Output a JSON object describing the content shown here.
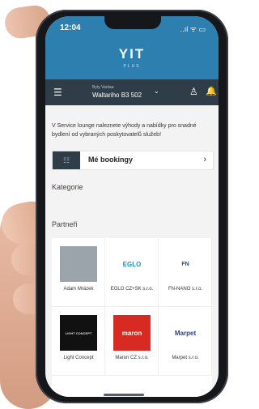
{
  "status": {
    "time": "12:04",
    "icons": "..ıl ᯤ ▭"
  },
  "brand": {
    "logo": "YIT",
    "sub": "PLUS"
  },
  "header": {
    "building_small": "Byty Vantaa",
    "address": "Waltariho  B3 502"
  },
  "intro_text": "V Service lounge naleznete výhody a nabídky pro snadné bydlení od vybraných poskytovatelů služeb!",
  "bookings": {
    "label": "Mé bookingy"
  },
  "sections": {
    "categories": "Kategorie",
    "partners": "Partneři"
  },
  "partners": [
    {
      "name": "Adam Mrázek",
      "logo": "",
      "color": "#9aa4aa",
      "text_color": "#fff"
    },
    {
      "name": "EGLO CZ+SK s.r.o.",
      "logo": "EGLO",
      "color": "#ffffff",
      "text_color": "#1c94c9"
    },
    {
      "name": "FN-NANO s.r.o.",
      "logo": "FN",
      "color": "#ffffff",
      "text_color": "#1f4f8c"
    },
    {
      "name": "Light Concept",
      "logo": "LIGHT CONCEPT",
      "color": "#111111",
      "text_color": "#ddd"
    },
    {
      "name": "Maron CZ s.r.o.",
      "logo": "maron",
      "color": "#d62a23",
      "text_color": "#fff"
    },
    {
      "name": "Marpet s.r.o.",
      "logo": "Marpet",
      "color": "#ffffff",
      "text_color": "#2b3e8c"
    }
  ],
  "colors": {
    "accent": "#2c7fae",
    "navbar": "#2f3d48"
  }
}
